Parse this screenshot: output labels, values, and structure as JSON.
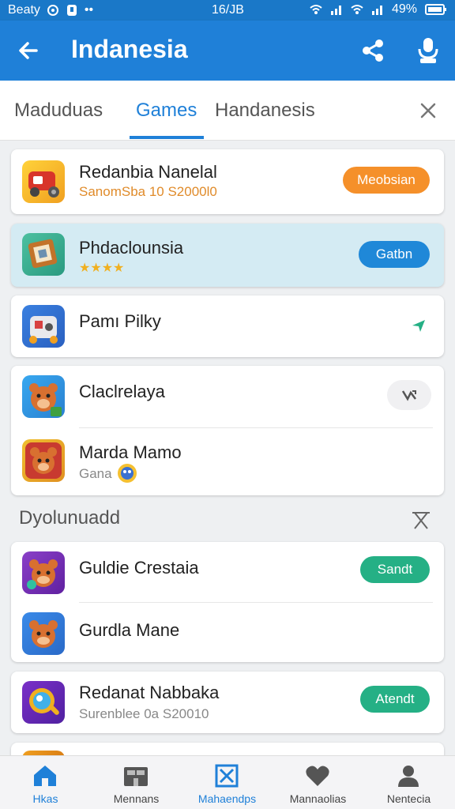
{
  "status": {
    "carrier": "Beaty",
    "time": "16/JB",
    "battery": "49%"
  },
  "header": {
    "title": "Indanesia"
  },
  "tabs": [
    {
      "label": "Maduduas"
    },
    {
      "label": "Games"
    },
    {
      "label": "Handanesis"
    }
  ],
  "items": [
    {
      "name": "Redanbia Nanelal",
      "sub": "SanomSba  10  S2000l0",
      "action": "Meobsian",
      "action_color": "#f5902a"
    },
    {
      "name": "Phdaclounsia",
      "rating_stars": "★★★★",
      "action": "Gatbn",
      "action_color": "#1f88d8"
    },
    {
      "name": "Pamı Pilky"
    },
    {
      "name": "Claclrelaya"
    },
    {
      "name": "Marda Mamo",
      "sub": "Gana"
    }
  ],
  "section": {
    "title": "Dyolunuadd"
  },
  "section_items": [
    {
      "name": "Guldie Crestaia",
      "action": "Sandt",
      "action_color": "#25b085"
    },
    {
      "name": "Gurdla Mane"
    },
    {
      "name": "Redanat Nabbaka",
      "sub": "Surenblee  0a  S20010",
      "action": "Atendt",
      "action_color": "#25b085"
    }
  ],
  "bottom_nav": [
    {
      "label": "Hkas",
      "icon": "home-icon"
    },
    {
      "label": "Mennans",
      "icon": "store-icon"
    },
    {
      "label": "Mahaendps",
      "icon": "box-x-icon"
    },
    {
      "label": "Mannaolias",
      "icon": "heart-icon"
    },
    {
      "label": "Nentecia",
      "icon": "person-icon"
    }
  ],
  "colors": {
    "primary": "#1f80d8",
    "orange": "#f5902a",
    "green": "#25b085"
  }
}
